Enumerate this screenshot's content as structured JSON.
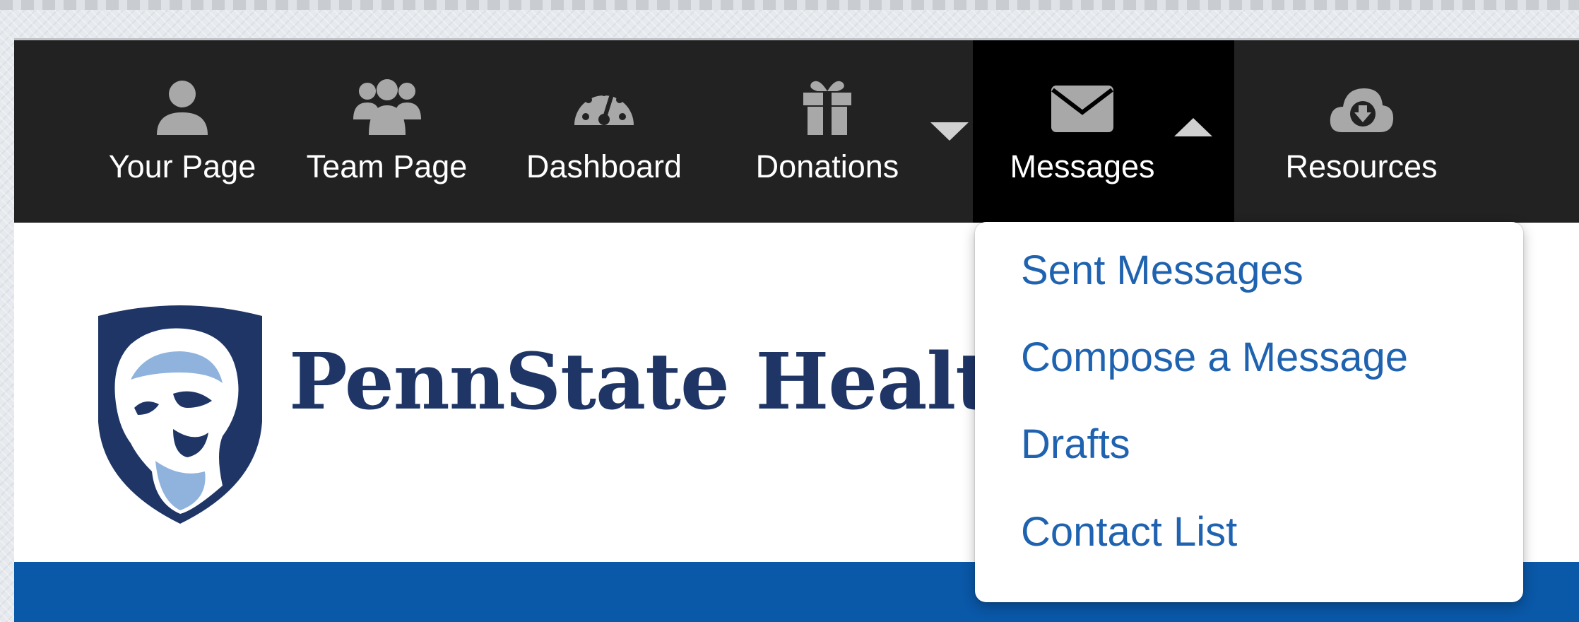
{
  "nav": {
    "items": [
      {
        "label": "Your Page",
        "icon": "user-icon"
      },
      {
        "label": "Team Page",
        "icon": "team-icon"
      },
      {
        "label": "Dashboard",
        "icon": "speedometer-icon"
      },
      {
        "label": "Donations",
        "icon": "gift-icon"
      },
      {
        "label": "Messages",
        "icon": "envelope-icon",
        "active": true
      },
      {
        "label": "Resources",
        "icon": "cloud-download-icon"
      }
    ]
  },
  "brand": {
    "name": "PennState Health",
    "logo_icon": "nittany-lion-shield-icon"
  },
  "messages_menu": {
    "items": [
      "Sent Messages",
      "Compose a Message",
      "Drafts",
      "Contact List"
    ]
  },
  "colors": {
    "navbar": "#222222",
    "nav_active": "#000000",
    "icon_gray": "#a8a8a8",
    "brand_navy": "#1e3566",
    "band_blue": "#0a58a8",
    "link_blue": "#1f63b0"
  }
}
